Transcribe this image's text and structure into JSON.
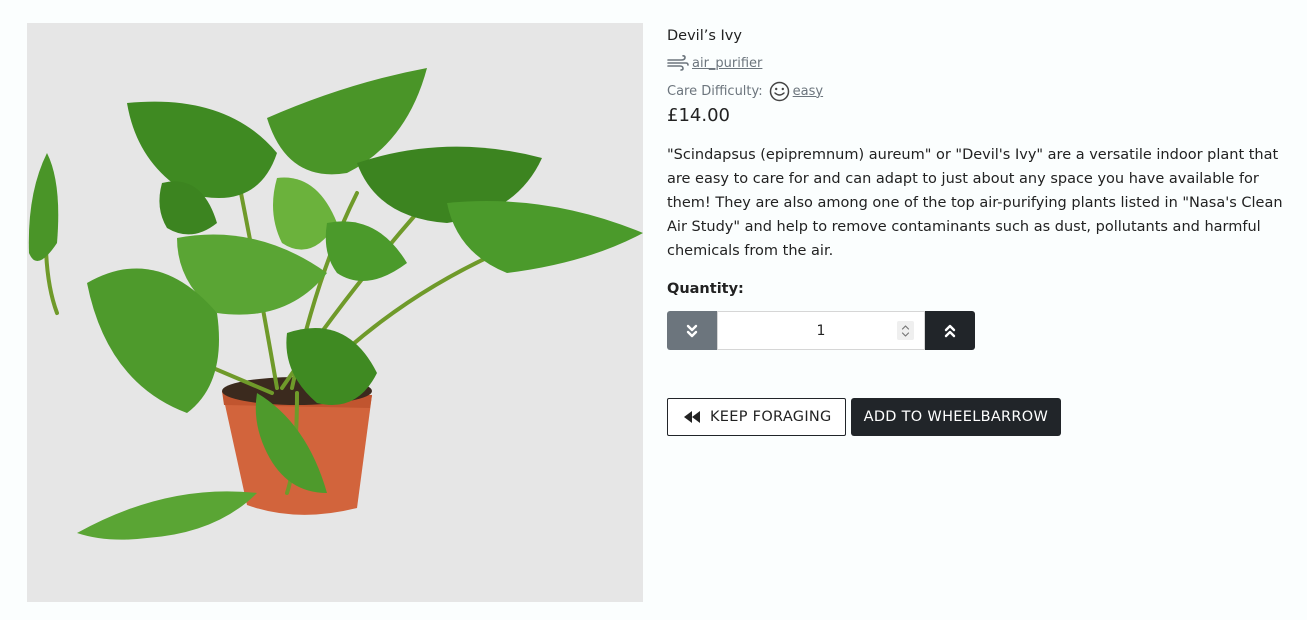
{
  "product": {
    "name": "Devil’s Ivy",
    "category_label": " air_purifier",
    "care_label": "Care Difficulty:",
    "care_value": " easy",
    "price": "£14.00",
    "description": "\"Scindapsus (epipremnum) aureum\" or \"Devil's Ivy\" are a versatile indoor plant that are easy to care for and can adapt to just about any space you have available for them! They are also among one of the top air-purifying plants listed in \"Nasa's Clean Air Study\" and help to remove contaminants such as dust, pollutants and harmful chemicals from the air."
  },
  "quantity": {
    "label": "Quantity:",
    "value": "1"
  },
  "actions": {
    "back_label": "KEEP FORAGING",
    "add_label": "ADD TO WHEELBARROW"
  },
  "icons": {
    "category": "wind-icon",
    "care": "smile-icon",
    "decrement": "chevrons-down-icon",
    "increment": "chevrons-up-icon",
    "back": "backward-icon"
  },
  "colors": {
    "dark": "#212529",
    "muted": "#6c757d",
    "image_bg": "#e6e6e6"
  }
}
